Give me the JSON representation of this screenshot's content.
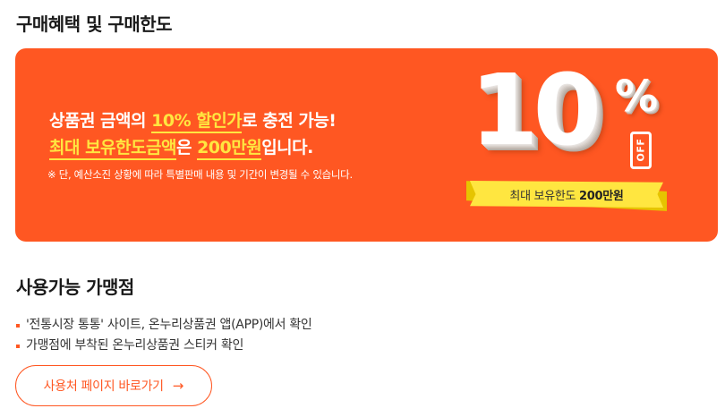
{
  "section1": {
    "title": "구매혜택 및 구매한도"
  },
  "banner": {
    "line1": {
      "before": "상품권 금액의 ",
      "highlight": "10% 할인가",
      "after": "로 충전 가능!"
    },
    "line2": {
      "hl1": "최대 보유한도금액",
      "mid": "은 ",
      "hl2": "200만원",
      "after": "입니다."
    },
    "note": "※ 단, 예산소진 상황에 따라 특별판매 내용 및 기간이 변경될 수 있습니다.",
    "badge": {
      "number": "10",
      "percent": "%",
      "off": "OFF",
      "ribbon_label": "최대 보유한도 ",
      "ribbon_value": "200만원"
    }
  },
  "section2": {
    "title": "사용가능 가맹점",
    "bullets": [
      "'전통시장 통통' 사이트, 온누리상품권 앱(APP)에서 확인",
      "가맹점에 부착된 온누리상품권 스티커 확인"
    ]
  },
  "button": {
    "label": "사용처 페이지 바로가기",
    "icon": "arrow-right-icon"
  },
  "colors": {
    "accent": "#ff5722",
    "highlight": "#ffe640",
    "text": "#222222"
  }
}
